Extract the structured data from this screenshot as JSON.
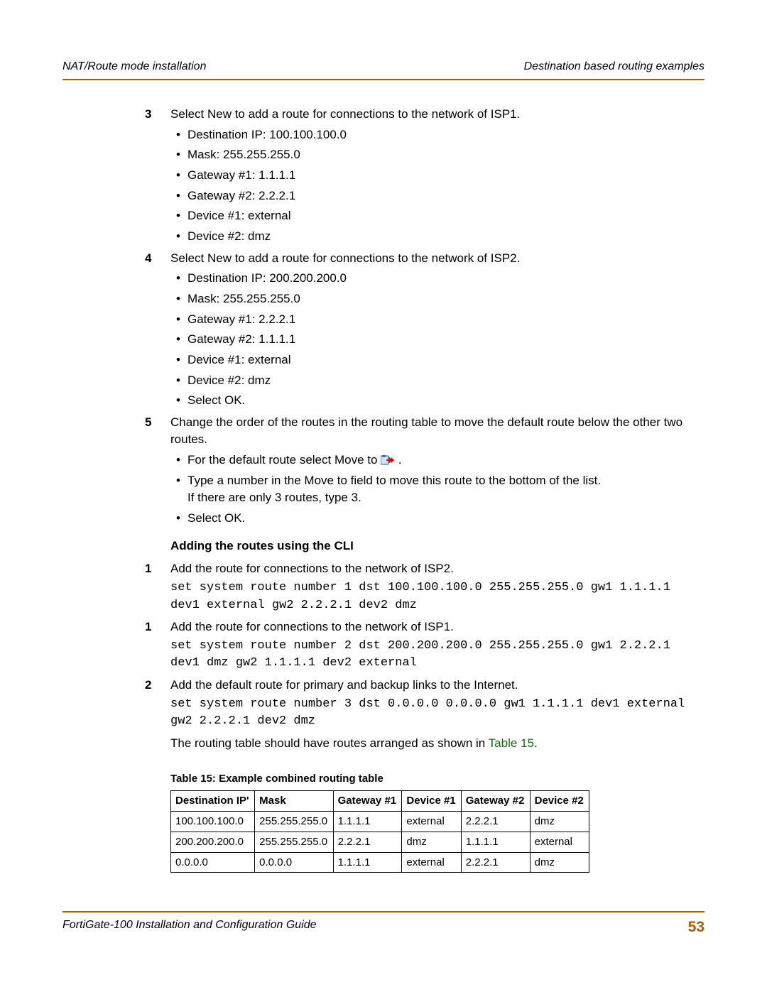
{
  "header": {
    "left": "NAT/Route mode installation",
    "right": "Destination based routing examples"
  },
  "footer": {
    "left": "FortiGate-100 Installation and Configuration Guide",
    "page": "53"
  },
  "steps": {
    "s3": {
      "num": "3",
      "text": "Select New to add a route for connections to the network of ISP1.",
      "bullets": [
        "Destination IP: 100.100.100.0",
        "Mask: 255.255.255.0",
        "Gateway #1: 1.1.1.1",
        "Gateway #2: 2.2.2.1",
        "Device #1: external",
        "Device #2: dmz"
      ]
    },
    "s4": {
      "num": "4",
      "text": "Select New to add a route for connections to the network of ISP2.",
      "bullets": [
        "Destination IP: 200.200.200.0",
        "Mask: 255.255.255.0",
        "Gateway #1: 2.2.2.1",
        "Gateway #2: 1.1.1.1",
        "Device #1: external",
        "Device #2: dmz",
        "Select OK."
      ]
    },
    "s5": {
      "num": "5",
      "text": "Change the order of the routes in the routing table to move the default route below the other two routes.",
      "b1": "For the default route select Move to ",
      "b2a": "Type a number in the Move to field to move this route to the bottom of the list.",
      "b2b": "If there are only 3 routes, type 3.",
      "b3": "Select OK."
    }
  },
  "cli": {
    "heading": "Adding the routes using the CLI",
    "c1": {
      "num": "1",
      "text": "Add the route for connections to the network of ISP2.",
      "code": "set system route number 1 dst 100.100.100.0 255.255.255.0 gw1 1.1.1.1 dev1 external gw2 2.2.2.1 dev2 dmz"
    },
    "c2": {
      "num": "1",
      "text": "Add the route for connections to the network of ISP1.",
      "code": "set system route number 2 dst 200.200.200.0 255.255.255.0 gw1 2.2.2.1 dev1 dmz gw2 1.1.1.1 dev2 external"
    },
    "c3": {
      "num": "2",
      "text": "Add the default route for primary and backup links to the Internet.",
      "code": "set system route number 3 dst 0.0.0.0 0.0.0.0 gw1 1.1.1.1 dev1 external gw2 2.2.2.1 dev2 dmz"
    },
    "after_prefix": "The routing table should have routes arranged as shown in ",
    "after_link": "Table 15",
    "after_suffix": "."
  },
  "table": {
    "caption": "Table 15: Example combined routing table",
    "headers": [
      "Destination IP'",
      "Mask",
      "Gateway #1",
      "Device #1",
      "Gateway #2",
      "Device #2"
    ],
    "rows": [
      [
        "100.100.100.0",
        "255.255.255.0",
        "1.1.1.1",
        "external",
        "2.2.2.1",
        "dmz"
      ],
      [
        "200.200.200.0",
        "255.255.255.0",
        "2.2.2.1",
        "dmz",
        "1.1.1.1",
        "external"
      ],
      [
        "0.0.0.0",
        "0.0.0.0",
        "1.1.1.1",
        "external",
        "2.2.2.1",
        "dmz"
      ]
    ]
  },
  "chart_data": {
    "type": "table",
    "title": "Table 15: Example combined routing table",
    "columns": [
      "Destination IP",
      "Mask",
      "Gateway #1",
      "Device #1",
      "Gateway #2",
      "Device #2"
    ],
    "rows": [
      [
        "100.100.100.0",
        "255.255.255.0",
        "1.1.1.1",
        "external",
        "2.2.2.1",
        "dmz"
      ],
      [
        "200.200.200.0",
        "255.255.255.0",
        "2.2.2.1",
        "dmz",
        "1.1.1.1",
        "external"
      ],
      [
        "0.0.0.0",
        "0.0.0.0",
        "1.1.1.1",
        "external",
        "2.2.2.1",
        "dmz"
      ]
    ]
  }
}
